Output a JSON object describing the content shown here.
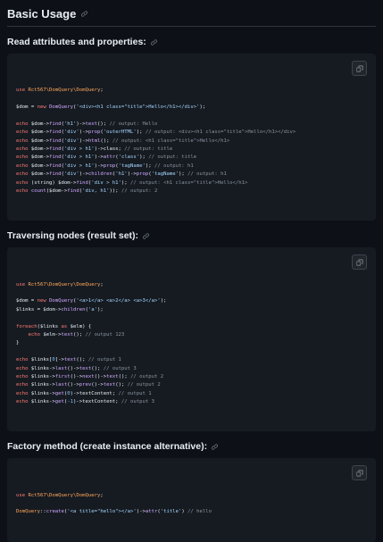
{
  "heading": "Basic Usage",
  "sections": [
    {
      "title": "Read attributes and properties:",
      "lines": [
        [
          [
            "kw",
            "use "
          ],
          [
            "cls",
            "Rct567\\DomQuery\\DomQuery"
          ],
          [
            "var",
            ";"
          ]
        ],
        [],
        [
          [
            "var",
            "$dom = "
          ],
          [
            "kw",
            "new "
          ],
          [
            "fn",
            "DomQuery"
          ],
          [
            "var",
            "("
          ],
          [
            "str",
            "'<div><h1 class=\"title\">Hello</h1></div>'"
          ],
          [
            "var",
            ");"
          ]
        ],
        [],
        [
          [
            "kw",
            "echo "
          ],
          [
            "var",
            "$dom->"
          ],
          [
            "fn",
            "find"
          ],
          [
            "var",
            "("
          ],
          [
            "str",
            "'h1'"
          ],
          [
            "var",
            ")->"
          ],
          [
            "fn",
            "text"
          ],
          [
            "var",
            "(); "
          ],
          [
            "cmt",
            "// output: Hello"
          ]
        ],
        [
          [
            "kw",
            "echo "
          ],
          [
            "var",
            "$dom->"
          ],
          [
            "fn",
            "find"
          ],
          [
            "var",
            "("
          ],
          [
            "str",
            "'div'"
          ],
          [
            "var",
            ")->"
          ],
          [
            "fn",
            "prop"
          ],
          [
            "var",
            "("
          ],
          [
            "str",
            "'outerHTML'"
          ],
          [
            "var",
            "); "
          ],
          [
            "cmt",
            "// output: <div><h1 class=\"title\">Hello</h1></div>"
          ]
        ],
        [
          [
            "kw",
            "echo "
          ],
          [
            "var",
            "$dom->"
          ],
          [
            "fn",
            "find"
          ],
          [
            "var",
            "("
          ],
          [
            "str",
            "'div'"
          ],
          [
            "var",
            ")->"
          ],
          [
            "fn",
            "html"
          ],
          [
            "var",
            "(); "
          ],
          [
            "cmt",
            "// output: <h1 class=\"title\">Hello</h1>"
          ]
        ],
        [
          [
            "kw",
            "echo "
          ],
          [
            "var",
            "$dom->"
          ],
          [
            "fn",
            "find"
          ],
          [
            "var",
            "("
          ],
          [
            "str",
            "'div > h1'"
          ],
          [
            "var",
            ")->class; "
          ],
          [
            "cmt",
            "// output: title"
          ]
        ],
        [
          [
            "kw",
            "echo "
          ],
          [
            "var",
            "$dom->"
          ],
          [
            "fn",
            "find"
          ],
          [
            "var",
            "("
          ],
          [
            "str",
            "'div > h1'"
          ],
          [
            "var",
            ")->"
          ],
          [
            "fn",
            "attr"
          ],
          [
            "var",
            "("
          ],
          [
            "str",
            "'class'"
          ],
          [
            "var",
            "); "
          ],
          [
            "cmt",
            "// output: title"
          ]
        ],
        [
          [
            "kw",
            "echo "
          ],
          [
            "var",
            "$dom->"
          ],
          [
            "fn",
            "find"
          ],
          [
            "var",
            "("
          ],
          [
            "str",
            "'div > h1'"
          ],
          [
            "var",
            ")->"
          ],
          [
            "fn",
            "prop"
          ],
          [
            "var",
            "("
          ],
          [
            "str",
            "'tagName'"
          ],
          [
            "var",
            "); "
          ],
          [
            "cmt",
            "// output: h1"
          ]
        ],
        [
          [
            "kw",
            "echo "
          ],
          [
            "var",
            "$dom->"
          ],
          [
            "fn",
            "find"
          ],
          [
            "var",
            "("
          ],
          [
            "str",
            "'div'"
          ],
          [
            "var",
            ")->"
          ],
          [
            "fn",
            "children"
          ],
          [
            "var",
            "("
          ],
          [
            "str",
            "'h1'"
          ],
          [
            "var",
            ")->"
          ],
          [
            "fn",
            "prop"
          ],
          [
            "var",
            "("
          ],
          [
            "str",
            "'tagName'"
          ],
          [
            "var",
            "); "
          ],
          [
            "cmt",
            "// output: h1"
          ]
        ],
        [
          [
            "kw",
            "echo "
          ],
          [
            "var",
            "(string) $dom->"
          ],
          [
            "fn",
            "find"
          ],
          [
            "var",
            "("
          ],
          [
            "str",
            "'div > h1'"
          ],
          [
            "var",
            "); "
          ],
          [
            "cmt",
            "// output: <h1 class=\"title\">Hello</h1>"
          ]
        ],
        [
          [
            "kw",
            "echo "
          ],
          [
            "fn",
            "count"
          ],
          [
            "var",
            "($dom->"
          ],
          [
            "fn",
            "find"
          ],
          [
            "var",
            "("
          ],
          [
            "str",
            "'div, h1'"
          ],
          [
            "var",
            ")); "
          ],
          [
            "cmt",
            "// output: 2"
          ]
        ]
      ]
    },
    {
      "title": "Traversing nodes (result set):",
      "lines": [
        [
          [
            "kw",
            "use "
          ],
          [
            "cls",
            "Rct567\\DomQuery\\DomQuery"
          ],
          [
            "var",
            ";"
          ]
        ],
        [],
        [
          [
            "var",
            "$dom = "
          ],
          [
            "kw",
            "new "
          ],
          [
            "fn",
            "DomQuery"
          ],
          [
            "var",
            "("
          ],
          [
            "str",
            "'<a>1</a> <a>2</a> <a>3</a>'"
          ],
          [
            "var",
            ");"
          ]
        ],
        [
          [
            "var",
            "$links = $dom->"
          ],
          [
            "fn",
            "children"
          ],
          [
            "var",
            "("
          ],
          [
            "str",
            "'a'"
          ],
          [
            "var",
            ");"
          ]
        ],
        [],
        [
          [
            "kw",
            "foreach"
          ],
          [
            "var",
            "($links "
          ],
          [
            "kw",
            "as "
          ],
          [
            "var",
            "$elm) {"
          ]
        ],
        [
          [
            "var",
            "    "
          ],
          [
            "kw",
            "echo "
          ],
          [
            "var",
            "$elm->"
          ],
          [
            "fn",
            "text"
          ],
          [
            "var",
            "(); "
          ],
          [
            "cmt",
            "// output 123"
          ]
        ],
        [
          [
            "var",
            "}"
          ]
        ],
        [],
        [
          [
            "kw",
            "echo "
          ],
          [
            "var",
            "$links["
          ],
          [
            "num",
            "0"
          ],
          [
            "var",
            "]->"
          ],
          [
            "fn",
            "text"
          ],
          [
            "var",
            "(); "
          ],
          [
            "cmt",
            "// output 1"
          ]
        ],
        [
          [
            "kw",
            "echo "
          ],
          [
            "var",
            "$links->"
          ],
          [
            "fn",
            "last"
          ],
          [
            "var",
            "()->"
          ],
          [
            "fn",
            "text"
          ],
          [
            "var",
            "(); "
          ],
          [
            "cmt",
            "// output 3"
          ]
        ],
        [
          [
            "kw",
            "echo "
          ],
          [
            "var",
            "$links->"
          ],
          [
            "fn",
            "first"
          ],
          [
            "var",
            "()->"
          ],
          [
            "fn",
            "next"
          ],
          [
            "var",
            "()->"
          ],
          [
            "fn",
            "text"
          ],
          [
            "var",
            "(); "
          ],
          [
            "cmt",
            "// output 2"
          ]
        ],
        [
          [
            "kw",
            "echo "
          ],
          [
            "var",
            "$links->"
          ],
          [
            "fn",
            "last"
          ],
          [
            "var",
            "()->"
          ],
          [
            "fn",
            "prev"
          ],
          [
            "var",
            "()->"
          ],
          [
            "fn",
            "text"
          ],
          [
            "var",
            "(); "
          ],
          [
            "cmt",
            "// output 2"
          ]
        ],
        [
          [
            "kw",
            "echo "
          ],
          [
            "var",
            "$links->"
          ],
          [
            "fn",
            "get"
          ],
          [
            "var",
            "("
          ],
          [
            "num",
            "0"
          ],
          [
            "var",
            ")->textContent; "
          ],
          [
            "cmt",
            "// output 1"
          ]
        ],
        [
          [
            "kw",
            "echo "
          ],
          [
            "var",
            "$links->"
          ],
          [
            "fn",
            "get"
          ],
          [
            "var",
            "("
          ],
          [
            "num",
            "-1"
          ],
          [
            "var",
            ")->textContent; "
          ],
          [
            "cmt",
            "// output 3"
          ]
        ]
      ]
    },
    {
      "title": "Factory method (create instance alternative):",
      "lines": [
        [
          [
            "kw",
            "use "
          ],
          [
            "cls",
            "Rct567\\DomQuery\\DomQuery"
          ],
          [
            "var",
            ";"
          ]
        ],
        [],
        [
          [
            "cls",
            "DomQuery"
          ],
          [
            "var",
            "::"
          ],
          [
            "fn",
            "create"
          ],
          [
            "var",
            "("
          ],
          [
            "str",
            "'<a title=\"hello\"></a>'"
          ],
          [
            "var",
            ")->"
          ],
          [
            "fn",
            "attr"
          ],
          [
            "var",
            "("
          ],
          [
            "str",
            "'title'"
          ],
          [
            "var",
            ") "
          ],
          [
            "cmt",
            "// hello"
          ]
        ]
      ]
    }
  ]
}
